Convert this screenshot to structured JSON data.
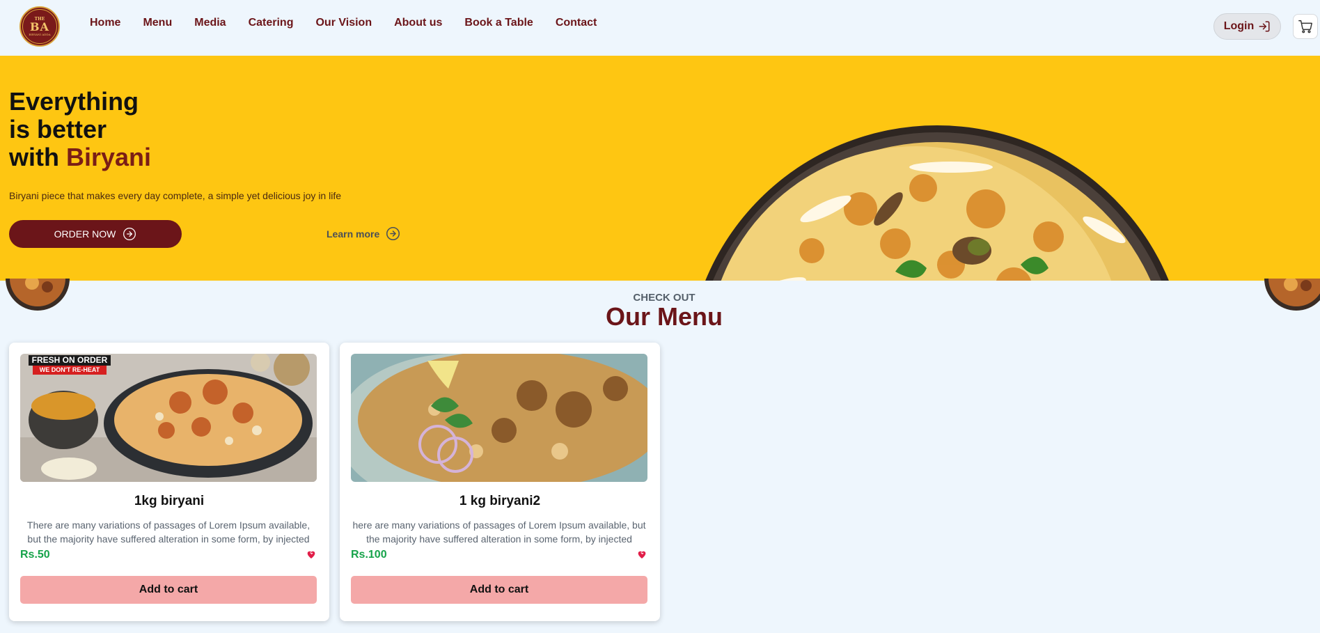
{
  "nav": {
    "logo": {
      "top": "THE",
      "mid": "BA",
      "bottom": "BIRYANI ADDA"
    },
    "links": [
      "Home",
      "Menu",
      "Media",
      "Catering",
      "Our Vision",
      "About us",
      "Book a Table",
      "Contact"
    ],
    "login_label": "Login",
    "login_icon": "login-arrow-icon",
    "cart_icon": "cart-icon"
  },
  "hero": {
    "title_line1": "Everything",
    "title_line2": "is better",
    "title_line3": "with",
    "title_accent": "Biryani",
    "subtitle": "Biryani piece that makes every day complete, a simple yet delicious joy in life",
    "order_label": "ORDER NOW",
    "learn_label": "Learn more",
    "background_color": "#fec612",
    "accent_color": "#7a1e16"
  },
  "menu": {
    "eyebrow": "CHECK OUT",
    "title": "Our Menu",
    "items": [
      {
        "name": "1kg biryani",
        "description": "There are many variations of passages of Lorem Ipsum available, but the majority have suffered alteration in some form, by injected",
        "price": "Rs.50",
        "add_label": "Add to cart",
        "badge_top": "FRESH ON ORDER",
        "badge_bottom": "WE DON'T RE-HEAT"
      },
      {
        "name": "1 kg biryani2",
        "description": "here are many variations of passages of Lorem Ipsum available, but the majority have suffered alteration in some form, by injected",
        "price": "Rs.100",
        "add_label": "Add to cart"
      }
    ]
  },
  "colors": {
    "brand": "#6b1519",
    "price": "#16a34a",
    "add_button": "#f4a8a8",
    "page_bg": "#eef6fd"
  }
}
